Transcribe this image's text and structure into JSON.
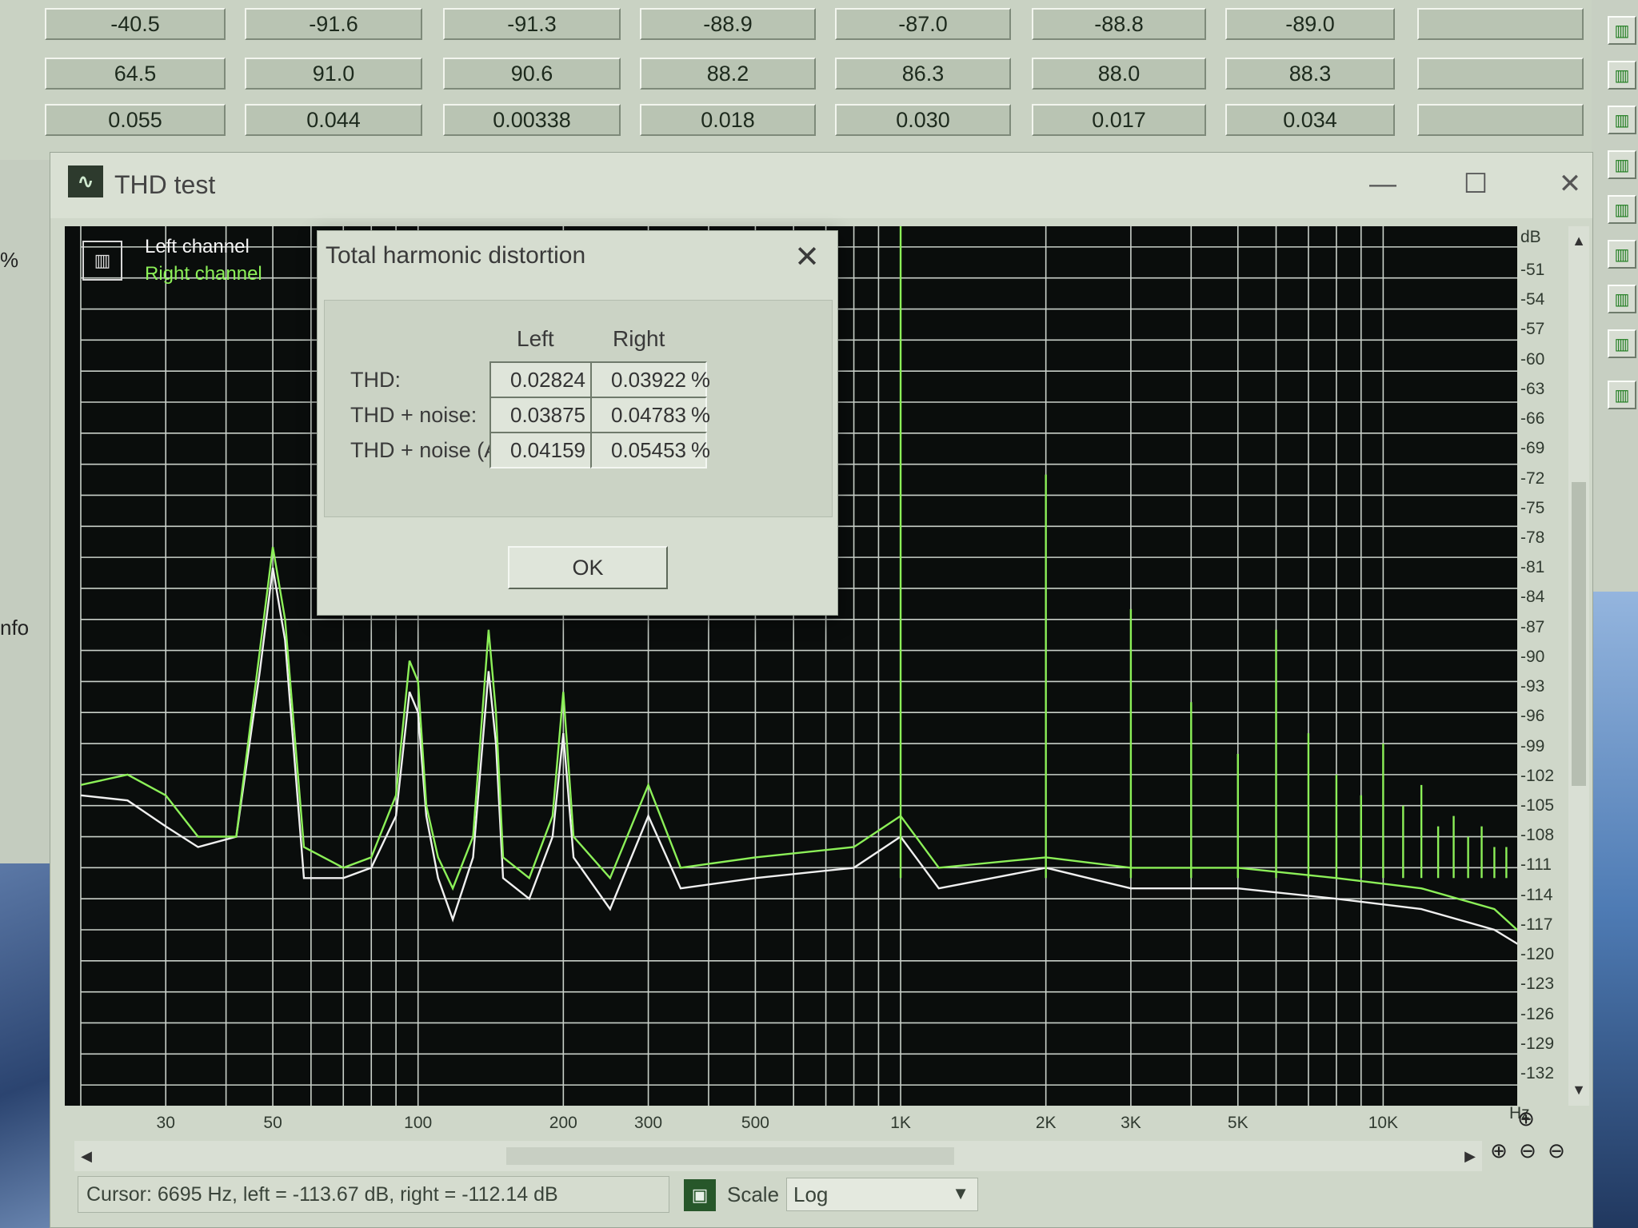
{
  "background_table": {
    "rows": [
      [
        "-40.5",
        "-91.6",
        "-91.3",
        "-88.9",
        "-87.0",
        "-88.8",
        "-89.0",
        ""
      ],
      [
        "64.5",
        "91.0",
        "90.6",
        "88.2",
        "86.3",
        "88.0",
        "88.3",
        ""
      ],
      [
        "0.055",
        "0.044",
        "0.00338",
        "0.018",
        "0.030",
        "0.017",
        "0.034",
        ""
      ]
    ]
  },
  "side_labels": {
    "percent": "%",
    "info": "nfo"
  },
  "window": {
    "title": "THD test",
    "minimize": "—",
    "maximize": "☐",
    "close": "✕"
  },
  "legend": {
    "left": "Left channel",
    "right": "Right channel",
    "left_color": "#f4f4f4",
    "right_color": "#8cf058"
  },
  "y_axis": {
    "unit": "dB",
    "ticks": [
      "-51",
      "-54",
      "-57",
      "-60",
      "-63",
      "-66",
      "-69",
      "-72",
      "-75",
      "-78",
      "-81",
      "-84",
      "-87",
      "-90",
      "-93",
      "-96",
      "-99",
      "-102",
      "-105",
      "-108",
      "-111",
      "-114",
      "-117",
      "-120",
      "-123",
      "-126",
      "-129",
      "-132"
    ]
  },
  "x_axis": {
    "unit": "Hz",
    "ticks": [
      {
        "label": "30",
        "hz": 30
      },
      {
        "label": "50",
        "hz": 50
      },
      {
        "label": "100",
        "hz": 100
      },
      {
        "label": "200",
        "hz": 200
      },
      {
        "label": "300",
        "hz": 300
      },
      {
        "label": "500",
        "hz": 500
      },
      {
        "label": "1K",
        "hz": 1000
      },
      {
        "label": "2K",
        "hz": 2000
      },
      {
        "label": "3K",
        "hz": 3000
      },
      {
        "label": "5K",
        "hz": 5000
      },
      {
        "label": "10K",
        "hz": 10000
      }
    ]
  },
  "chart_data": {
    "type": "line",
    "scale": "log",
    "xlim": [
      20,
      20000
    ],
    "ylim": [
      -134,
      -49
    ],
    "grid": true,
    "legend": "top-left",
    "series": [
      {
        "name": "Left channel",
        "color": "#f0f0f0",
        "points": [
          [
            20,
            -104
          ],
          [
            25,
            -104.5
          ],
          [
            30,
            -107
          ],
          [
            35,
            -109
          ],
          [
            42,
            -108
          ],
          [
            47,
            -92
          ],
          [
            50,
            -82
          ],
          [
            53,
            -89
          ],
          [
            58,
            -112
          ],
          [
            70,
            -112
          ],
          [
            80,
            -111
          ],
          [
            90,
            -106
          ],
          [
            96,
            -94
          ],
          [
            100,
            -96
          ],
          [
            104,
            -106
          ],
          [
            110,
            -112
          ],
          [
            118,
            -116
          ],
          [
            130,
            -110
          ],
          [
            140,
            -92
          ],
          [
            145,
            -99
          ],
          [
            150,
            -112
          ],
          [
            170,
            -114
          ],
          [
            190,
            -108
          ],
          [
            200,
            -98
          ],
          [
            210,
            -110
          ],
          [
            250,
            -115
          ],
          [
            300,
            -106
          ],
          [
            350,
            -113
          ],
          [
            500,
            -112
          ],
          [
            800,
            -111
          ],
          [
            1000,
            -108
          ],
          [
            1200,
            -113
          ],
          [
            2000,
            -111
          ],
          [
            3000,
            -113
          ],
          [
            5000,
            -113
          ],
          [
            8000,
            -114
          ],
          [
            12000,
            -115
          ],
          [
            17000,
            -117
          ],
          [
            20000,
            -119
          ]
        ]
      },
      {
        "name": "Right channel",
        "color": "#8cf058",
        "points": [
          [
            20,
            -103
          ],
          [
            25,
            -102
          ],
          [
            30,
            -104
          ],
          [
            35,
            -108
          ],
          [
            42,
            -108
          ],
          [
            47,
            -90
          ],
          [
            50,
            -80
          ],
          [
            53,
            -87
          ],
          [
            58,
            -109
          ],
          [
            70,
            -111
          ],
          [
            80,
            -110
          ],
          [
            90,
            -104
          ],
          [
            96,
            -91
          ],
          [
            100,
            -93
          ],
          [
            104,
            -105
          ],
          [
            110,
            -110
          ],
          [
            118,
            -113
          ],
          [
            130,
            -108
          ],
          [
            140,
            -88
          ],
          [
            145,
            -96
          ],
          [
            150,
            -110
          ],
          [
            170,
            -112
          ],
          [
            190,
            -106
          ],
          [
            200,
            -94
          ],
          [
            210,
            -108
          ],
          [
            250,
            -112
          ],
          [
            300,
            -103
          ],
          [
            350,
            -111
          ],
          [
            500,
            -110
          ],
          [
            800,
            -109
          ],
          [
            1000,
            -106
          ],
          [
            1200,
            -111
          ],
          [
            2000,
            -110
          ],
          [
            3000,
            -111
          ],
          [
            5000,
            -111
          ],
          [
            8000,
            -112
          ],
          [
            12000,
            -113
          ],
          [
            17000,
            -115
          ],
          [
            20000,
            -118
          ]
        ]
      }
    ],
    "spikes": [
      {
        "hz": 1000,
        "db": -49
      },
      {
        "hz": 2000,
        "db": -73
      },
      {
        "hz": 3000,
        "db": -86
      },
      {
        "hz": 4000,
        "db": -95
      },
      {
        "hz": 5000,
        "db": -100
      },
      {
        "hz": 6000,
        "db": -88
      },
      {
        "hz": 7000,
        "db": -98
      },
      {
        "hz": 8000,
        "db": -102
      },
      {
        "hz": 9000,
        "db": -104
      },
      {
        "hz": 10000,
        "db": -99
      },
      {
        "hz": 11000,
        "db": -105
      },
      {
        "hz": 12000,
        "db": -103
      },
      {
        "hz": 13000,
        "db": -107
      },
      {
        "hz": 14000,
        "db": -106
      },
      {
        "hz": 15000,
        "db": -108
      },
      {
        "hz": 16000,
        "db": -107
      },
      {
        "hz": 17000,
        "db": -109
      },
      {
        "hz": 18000,
        "db": -109
      }
    ]
  },
  "dialog": {
    "title": "Total harmonic distortion",
    "close": "✕",
    "columns": {
      "left": "Left",
      "right": "Right"
    },
    "rows": [
      {
        "label": "THD:",
        "left": "0.02824",
        "right": "0.03922",
        "unit": "%"
      },
      {
        "label": "THD + noise:",
        "left": "0.03875",
        "right": "0.04783",
        "unit": "%"
      },
      {
        "label": "THD + noise (A):",
        "left": "0.04159",
        "right": "0.05453",
        "unit": "%"
      }
    ],
    "ok": "OK"
  },
  "status": {
    "cursor": "Cursor: 6695 Hz, left = -113.67 dB, right = -112.14 dB",
    "scale_label": "Scale",
    "scale_value": "Log"
  }
}
